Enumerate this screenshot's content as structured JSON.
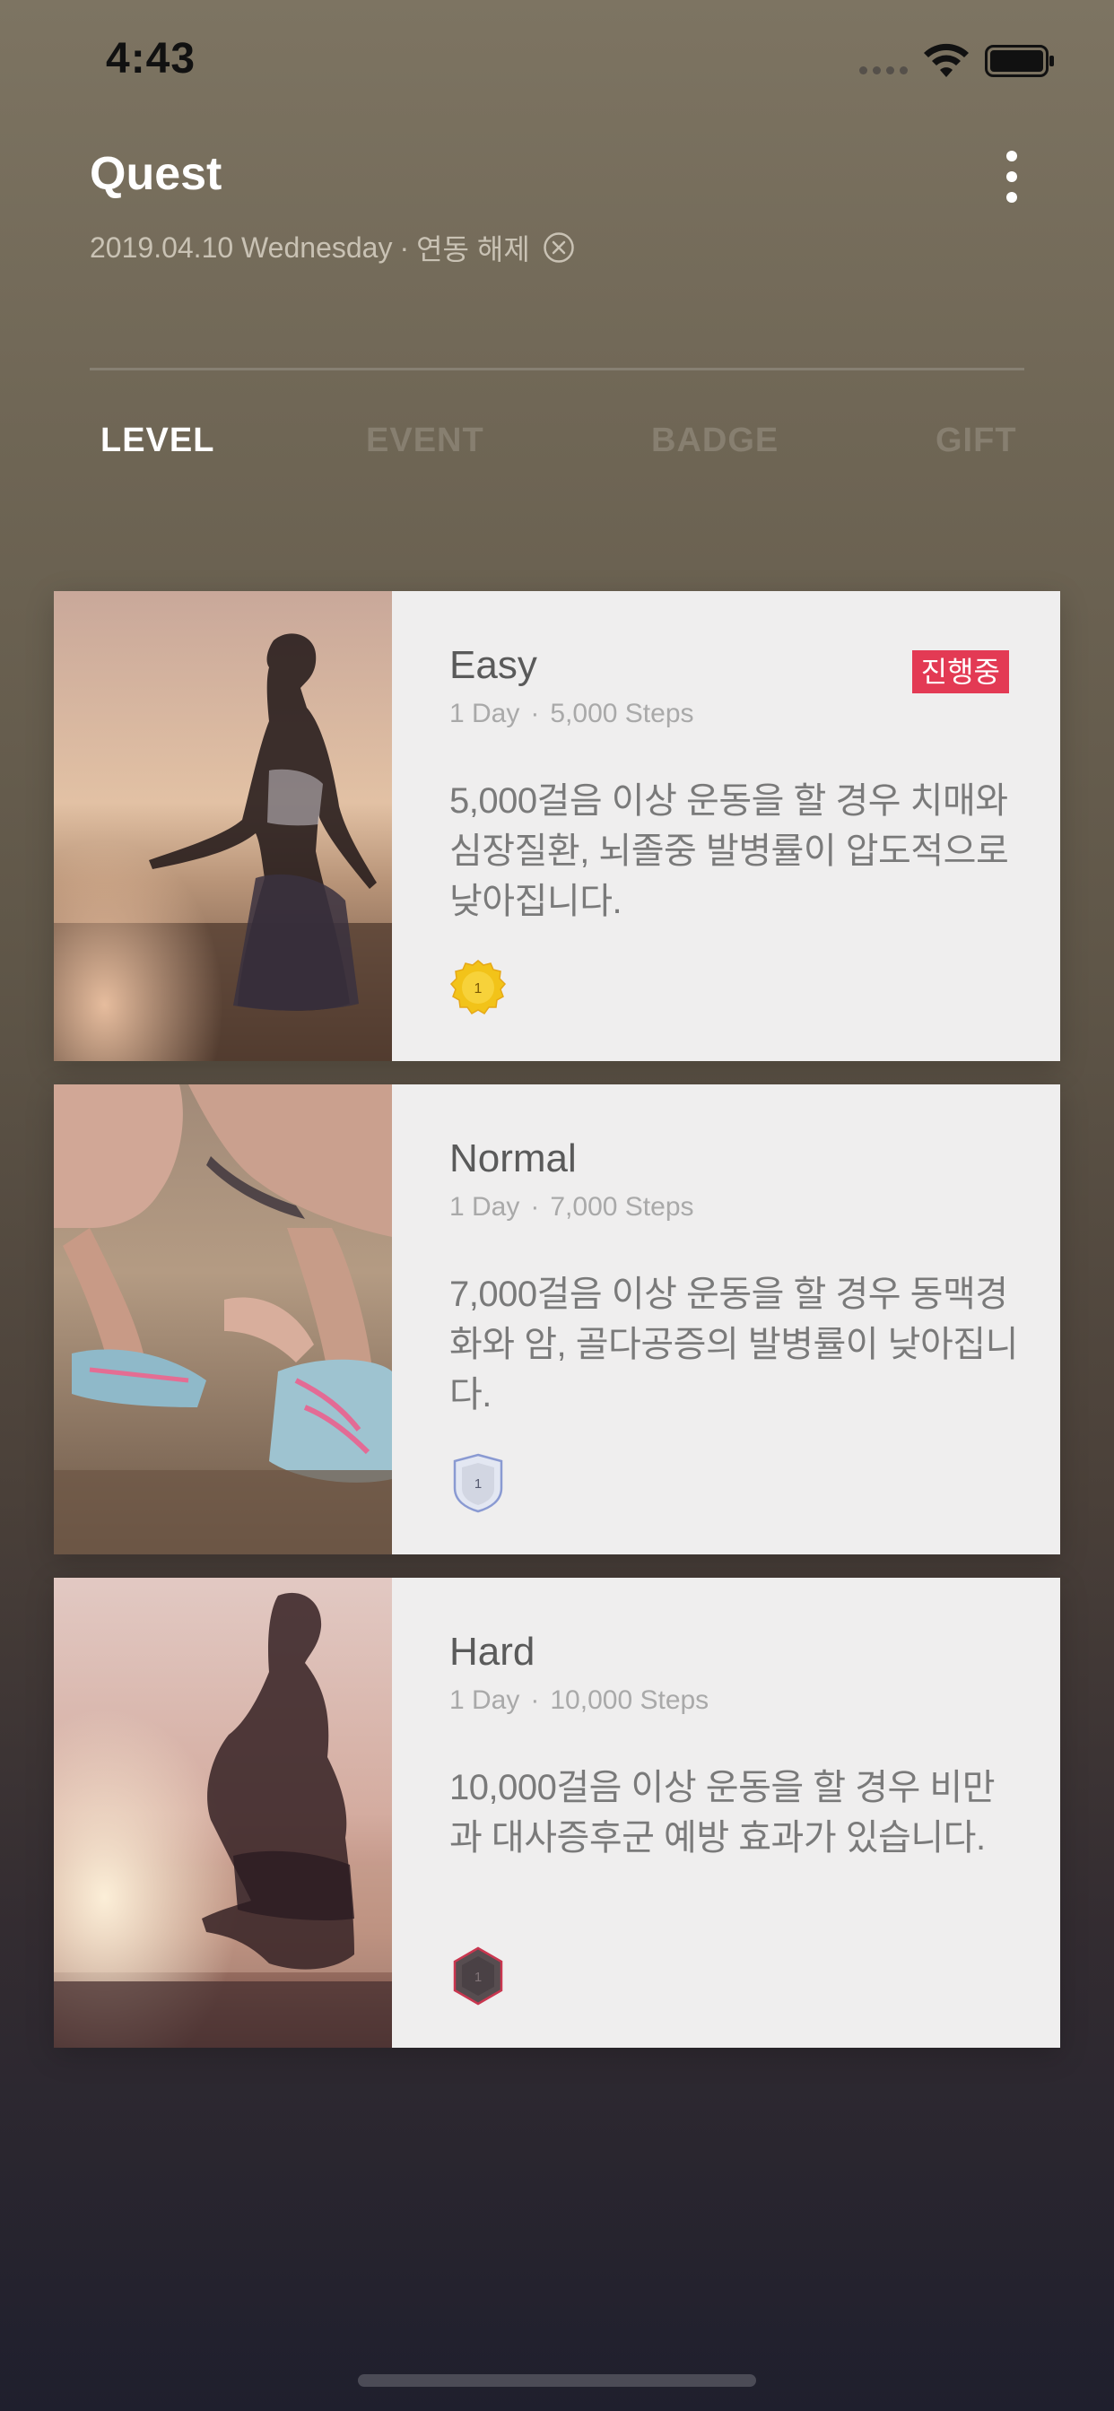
{
  "status_bar": {
    "time": "4:43"
  },
  "header": {
    "title": "Quest",
    "date": "2019.04.10 Wednesday",
    "separator": "·",
    "unlink_label": "연동 해제"
  },
  "tabs": [
    {
      "label": "LEVEL",
      "active": true
    },
    {
      "label": "EVENT",
      "active": false
    },
    {
      "label": "BADGE",
      "active": false
    },
    {
      "label": "GIFT",
      "active": false
    }
  ],
  "cards": [
    {
      "title": "Easy",
      "duration": "1 Day",
      "steps": "5,000 Steps",
      "dot": "·",
      "description": "5,000걸음 이상 운동을 할 경우 치매와 심장질환, 뇌졸중 발병률이 압도적으로 낮아집니다.",
      "status": "진행중",
      "badge_number": "1",
      "badge_icon": "gold-medal-icon"
    },
    {
      "title": "Normal",
      "duration": "1 Day",
      "steps": "7,000 Steps",
      "dot": "·",
      "description": "7,000걸음 이상 운동을 할 경우 동맥경화와 암, 골다공증의 발병률이 낮아집니다.",
      "badge_number": "1",
      "badge_icon": "silver-shield-icon"
    },
    {
      "title": "Hard",
      "duration": "1 Day",
      "steps": "10,000 Steps",
      "dot": "·",
      "description": "10,000걸음 이상 운동을 할 경우 비만과 대사증후군 예방 효과가 있습니다.",
      "badge_number": "1",
      "badge_icon": "dark-hexagon-icon"
    }
  ],
  "colors": {
    "status_badge": "#e33a54",
    "card_background": "#efeeee",
    "active_tab": "#ffffff"
  }
}
